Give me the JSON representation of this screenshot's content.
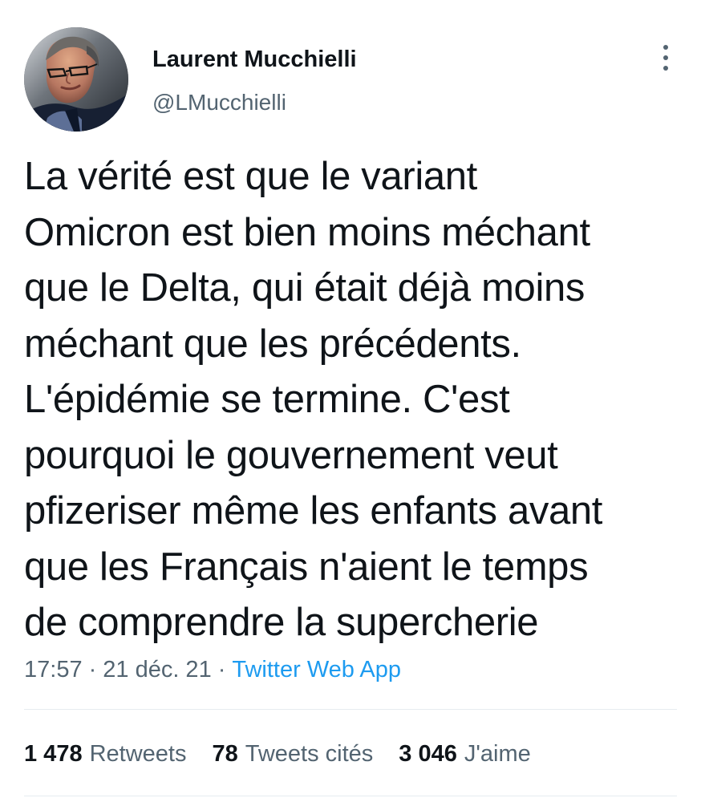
{
  "tweet": {
    "author": {
      "display_name": "Laurent Mucchielli",
      "handle": "@LMucchielli"
    },
    "text": "La vérité est que le variant\nOmicron est bien moins méchant\nque le Delta, qui était déjà moins\nméchant que les précédents.\nL'épidémie se termine. C'est\npourquoi le gouvernement veut\npfizeriser même les enfants avant\nque les Français n'aient le temps\nde comprendre la supercherie",
    "time": "17:57",
    "separator": "·",
    "date": "21 déc. 21",
    "source": "Twitter Web App",
    "stats": {
      "retweets_count": "1 478",
      "retweets_label": "Retweets",
      "quote_tweets_count": "78",
      "quote_tweets_label": "Tweets cités",
      "likes_count": "3 046",
      "likes_label": "J'aime"
    }
  },
  "icons": {
    "more": "more-options-icon",
    "avatar": "profile-photo"
  },
  "colors": {
    "text_primary": "#0f1419",
    "text_secondary": "#536471",
    "accent": "#1d9bf0",
    "divider": "#e6ecf0",
    "background": "#ffffff"
  }
}
